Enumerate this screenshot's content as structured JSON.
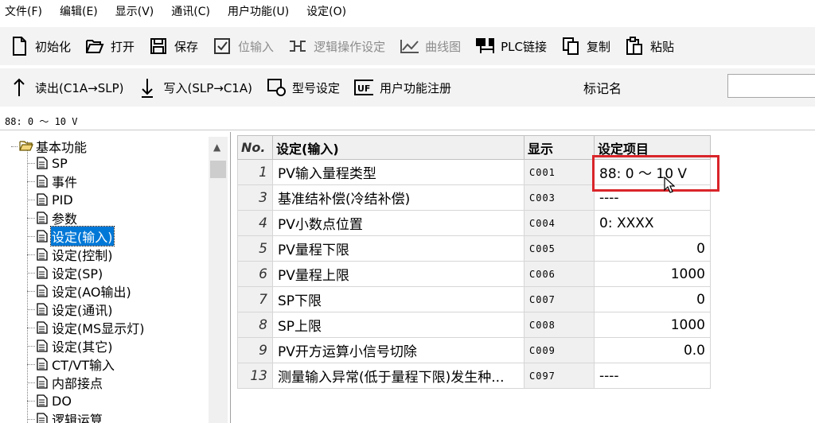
{
  "menu": [
    "文件(F)",
    "编辑(E)",
    "显示(V)",
    "通讯(C)",
    "用户功能(U)",
    "设定(O)"
  ],
  "toolbar1": [
    {
      "label": "初始化",
      "icon": "new-file-icon",
      "enabled": true
    },
    {
      "label": "打开",
      "icon": "open-folder-icon",
      "enabled": true
    },
    {
      "label": "保存",
      "icon": "save-icon",
      "enabled": true
    },
    {
      "label": "位输入",
      "icon": "checkbox-icon",
      "enabled": false
    },
    {
      "label": "逻辑操作设定",
      "icon": "logic-icon",
      "enabled": false
    },
    {
      "label": "曲线图",
      "icon": "chart-line-icon",
      "enabled": false
    },
    {
      "label": "PLC链接",
      "icon": "plc-link-icon",
      "enabled": true
    },
    {
      "label": "复制",
      "icon": "copy-icon",
      "enabled": true
    },
    {
      "label": "粘贴",
      "icon": "paste-icon",
      "enabled": true
    }
  ],
  "toolbar2": [
    {
      "label": "读出(C1A→SLP)",
      "icon": "upload-arrow-icon"
    },
    {
      "label": "写入(SLP→C1A)",
      "icon": "download-arrow-icon"
    },
    {
      "label": "型号设定",
      "icon": "model-settings-icon"
    },
    {
      "label": "用户功能注册",
      "icon": "uf-icon"
    }
  ],
  "marker_label": "标记名",
  "status_text": "88:  0 ～  10 V",
  "tree": {
    "root": "基本功能",
    "items": [
      "SP",
      "事件",
      "PID",
      "参数",
      "设定(输入)",
      "设定(控制)",
      "设定(SP)",
      "设定(AO输出)",
      "设定(通讯)",
      "设定(MS显示灯)",
      "设定(其它)",
      "CT/VT输入",
      "内部接点",
      "DO",
      "逻辑运算"
    ],
    "selected_index": 4
  },
  "grid": {
    "headers": {
      "no": "No.",
      "name": "设定(输入)",
      "display": "显示",
      "value": "设定项目"
    },
    "rows": [
      {
        "no": "1",
        "name": "PV输入量程类型",
        "display": "C001",
        "value": "88:  0 ～ 10 V",
        "align": "left"
      },
      {
        "no": "3",
        "name": "基准结补偿(冷结补偿)",
        "display": "C003",
        "value": "----",
        "align": "left"
      },
      {
        "no": "4",
        "name": "PV小数点位置",
        "display": "C004",
        "value": "0: XXXX",
        "align": "left"
      },
      {
        "no": "5",
        "name": "PV量程下限",
        "display": "C005",
        "value": "0",
        "align": "right"
      },
      {
        "no": "6",
        "name": "PV量程上限",
        "display": "C006",
        "value": "1000",
        "align": "right"
      },
      {
        "no": "7",
        "name": "SP下限",
        "display": "C007",
        "value": "0",
        "align": "right"
      },
      {
        "no": "8",
        "name": "SP上限",
        "display": "C008",
        "value": "1000",
        "align": "right"
      },
      {
        "no": "9",
        "name": "PV开方运算小信号切除",
        "display": "C009",
        "value": "0.0",
        "align": "right"
      },
      {
        "no": "13",
        "name": "测量输入异常(低于量程下限)发生种...",
        "display": "C097",
        "value": "----",
        "align": "left"
      }
    ]
  },
  "colors": {
    "highlight": "#d9252a",
    "selection": "#0078d7"
  }
}
